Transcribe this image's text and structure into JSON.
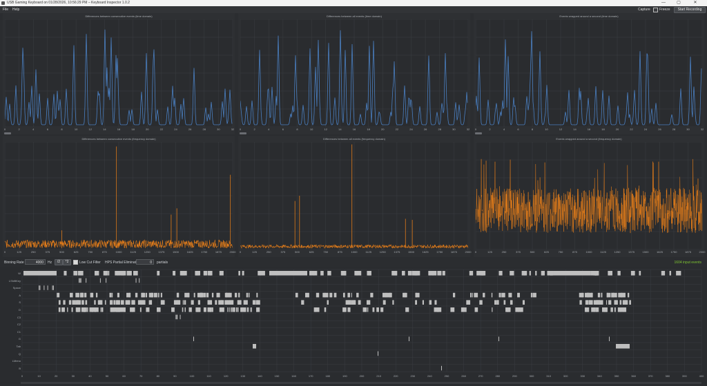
{
  "window": {
    "title": "USB Gaming Keyboard on 01/28/2026, 10:56:29 PM – Keyboard Inspector 1.0.2",
    "minimize": "—",
    "maximize": "▢",
    "close": "✕"
  },
  "menu": {
    "file": "File",
    "help": "Help",
    "capture_label": "Capture",
    "freeze_label": "Freeze",
    "start_recording": "Start Recording"
  },
  "colors": {
    "time_series": "#4a7fc1",
    "frequency_series": "#e07b1a",
    "grid": "#3b3e42",
    "bar": "#bfbfbf",
    "status": "#7ec531"
  },
  "panels": [
    {
      "title": "Differences between consecutive events (time domain)",
      "ticks": [
        "0",
        "2",
        "4",
        "6",
        "8",
        "10",
        "12",
        "14",
        "16",
        "18",
        "20",
        "22",
        "24",
        "26",
        "28",
        "30",
        "32"
      ]
    },
    {
      "title": "Differences between all events (time domain)",
      "ticks": [
        "0",
        "2",
        "4",
        "6",
        "8",
        "10",
        "12",
        "14",
        "16",
        "18",
        "20",
        "22",
        "24",
        "26",
        "28",
        "30",
        "32"
      ]
    },
    {
      "title": "Events wrapped around a second (time domain)",
      "ticks": [
        "0",
        "2",
        "4",
        "6",
        "8",
        "10",
        "12",
        "14",
        "16",
        "18",
        "20",
        "22",
        "24",
        "26",
        "28",
        "30",
        "32"
      ]
    },
    {
      "title": "Differences between consecutive events (frequency domain)",
      "ticks": [
        "0",
        "125",
        "250",
        "375",
        "500",
        "625",
        "750",
        "875",
        "1000",
        "1125",
        "1250",
        "1375",
        "1500",
        "1625",
        "1750",
        "1875",
        "2000"
      ]
    },
    {
      "title": "Differences between all events (frequency domain)",
      "ticks": [
        "0",
        "125",
        "250",
        "375",
        "500",
        "625",
        "750",
        "875",
        "1000",
        "1125",
        "1250",
        "1375",
        "1500",
        "1625",
        "1750",
        "1875",
        "2000"
      ]
    },
    {
      "title": "Events wrapped around a second (frequency domain)",
      "ticks": [
        "0",
        "125",
        "250",
        "375",
        "500",
        "625",
        "750",
        "875",
        "1000",
        "1125",
        "1250",
        "1375",
        "1500",
        "1625",
        "1750",
        "1875",
        "2000"
      ]
    }
  ],
  "controls": {
    "binning_rate_label": "Binning Rate",
    "binning_rate_value": "4000",
    "hz_label": "Hz",
    "div2": "/2",
    "mul2": "*2",
    "low_cut_label": "Low Cut Filter",
    "hps_label": "HPS Partial Elimination",
    "hps_value": "0",
    "partials_label": "partials",
    "input_events": "1604 input events"
  },
  "timeline": {
    "keys": [
      "W",
      "LShiftKey",
      "Space",
      "A",
      "S",
      "D",
      "C3",
      "C2",
      "C1",
      "G",
      "Tab",
      "Q",
      "LMenu",
      "B"
    ],
    "ticks": [
      "0",
      "10",
      "20",
      "30",
      "40",
      "50",
      "60",
      "70",
      "80",
      "90",
      "100",
      "110",
      "120",
      "130",
      "140",
      "150",
      "160",
      "170",
      "180",
      "190",
      "200",
      "210",
      "220",
      "230",
      "240",
      "250",
      "260",
      "270",
      "280",
      "290",
      "300",
      "310",
      "320",
      "330",
      "340",
      "350",
      "360",
      "370",
      "380",
      "390",
      "400"
    ]
  }
}
